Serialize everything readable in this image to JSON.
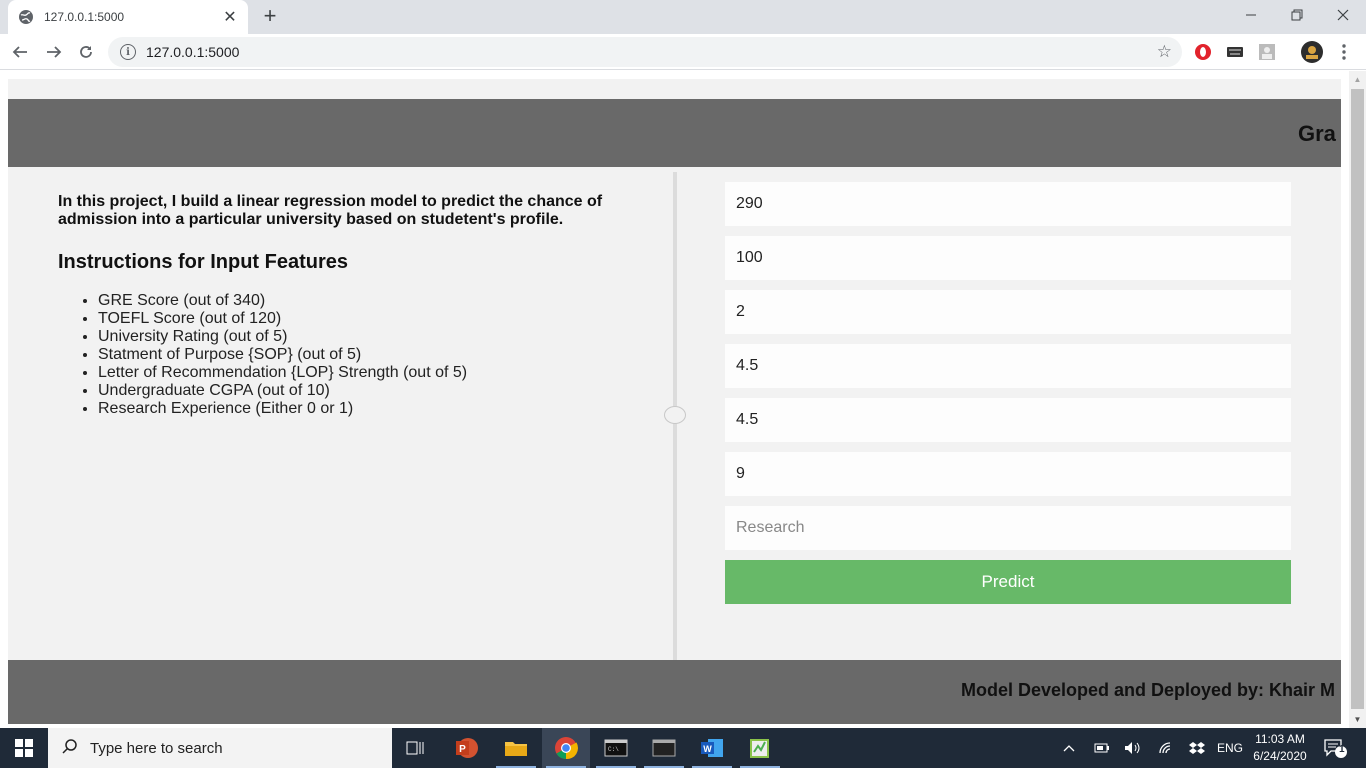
{
  "browser": {
    "tab_title": "127.0.0.1:5000",
    "url": "127.0.0.1:5000"
  },
  "page": {
    "header_title": "Gra",
    "intro": "In this project, I build a linear regression model to predict the chance of admission into a particular university based on studetent's profile.",
    "instructions_title": "Instructions for Input Features",
    "features": [
      "GRE Score (out of 340)",
      "TOEFL Score (out of 120)",
      "University Rating (out of 5)",
      "Statment of Purpose {SOP} (out of 5)",
      "Letter of Recommendation {LOP} Strength (out of 5)",
      "Undergraduate CGPA (out of 10)",
      "Research Experience (Either 0 or 1)"
    ],
    "form": {
      "gre_value": "290",
      "toefl_value": "100",
      "rating_value": "2",
      "sop_value": "4.5",
      "lor_value": "4.5",
      "cgpa_value": "9",
      "research_value": "",
      "research_placeholder": "Research",
      "predict_label": "Predict"
    },
    "footer_text": "Model Developed and Deployed by: Khair M"
  },
  "taskbar": {
    "search_placeholder": "Type here to search",
    "language": "ENG",
    "time": "11:03 AM",
    "date": "6/24/2020",
    "notification_count": "1"
  },
  "colors": {
    "header_bg": "#696969",
    "page_bg": "#f2f2f2",
    "predict_bg": "#67b968",
    "taskbar_bg": "#1f2a38"
  }
}
